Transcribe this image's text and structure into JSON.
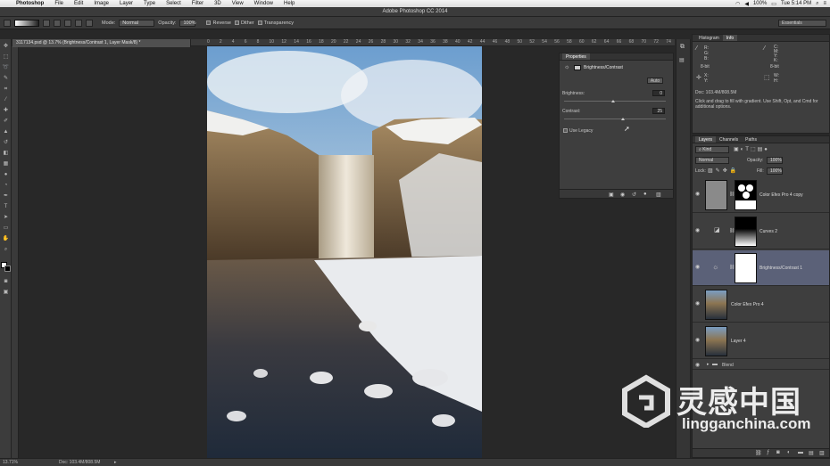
{
  "menubar": {
    "app": "Photoshop",
    "items": [
      "File",
      "Edit",
      "Image",
      "Layer",
      "Type",
      "Select",
      "Filter",
      "3D",
      "View",
      "Window",
      "Help"
    ],
    "battery": "100%",
    "clock": "Tue 5:14 PM"
  },
  "window": {
    "title": "Adobe Photoshop CC 2014"
  },
  "options": {
    "mode_label": "Mode:",
    "mode_value": "Normal",
    "opacity_label": "Opacity:",
    "opacity_value": "100%",
    "reverse": "Reverse",
    "dither": "Dither",
    "transparency": "Transparency",
    "workspace": "Essentials"
  },
  "document": {
    "tab": "3117134.psd @ 13.7% (Brightness/Contrast 1, Layer Mask/8) *",
    "ruler_top": [
      "0",
      "2",
      "4",
      "6",
      "8",
      "10",
      "12",
      "14",
      "16",
      "18",
      "20",
      "22",
      "24",
      "26",
      "28",
      "30",
      "32",
      "34",
      "36",
      "38",
      "40",
      "42",
      "44",
      "46",
      "48",
      "50",
      "52",
      "54",
      "56",
      "58",
      "60",
      "62",
      "64",
      "66",
      "68",
      "70",
      "72",
      "74"
    ]
  },
  "properties": {
    "panel_title": "Properties",
    "adjustment": "Brightness/Contrast",
    "auto": "Auto",
    "brightness_label": "Brightness:",
    "brightness_value": "0",
    "contrast_label": "Contrast:",
    "contrast_value": "25",
    "use_legacy": "Use Legacy"
  },
  "info": {
    "tabs": [
      "Histogram",
      "Info"
    ],
    "r": "R:",
    "g": "G:",
    "b": "B:",
    "c": "C:",
    "m": "M:",
    "y": "Y:",
    "k": "K:",
    "bit_left": "8-bit",
    "bit_right": "8-bit",
    "x": "X:",
    "y2": "Y:",
    "w": "W:",
    "h": "H:",
    "doc": "Doc: 103.4M/808.5M",
    "hint": "Click and drag to fill with gradient.  Use Shift, Opt, and Cmd for additional options."
  },
  "layers": {
    "tabs": [
      "Layers",
      "Channels",
      "Paths"
    ],
    "kind": "Kind",
    "blend": "Normal",
    "opacity_label": "Opacity:",
    "opacity_value": "100%",
    "lock_label": "Lock:",
    "fill_label": "Fill:",
    "fill_value": "100%",
    "items": [
      {
        "name": "Color Efex Pro 4 copy"
      },
      {
        "name": "Curves 2"
      },
      {
        "name": "Brightness/Contrast 1"
      },
      {
        "name": "Color Efex Pro 4"
      },
      {
        "name": "Layer 4"
      },
      {
        "name": "Blend"
      }
    ]
  },
  "status": {
    "zoom": "13.71%",
    "doc": "Doc: 103.4M/808.5M"
  },
  "watermark": {
    "brand": "灵感中国",
    "url": "lingganchina.com"
  }
}
